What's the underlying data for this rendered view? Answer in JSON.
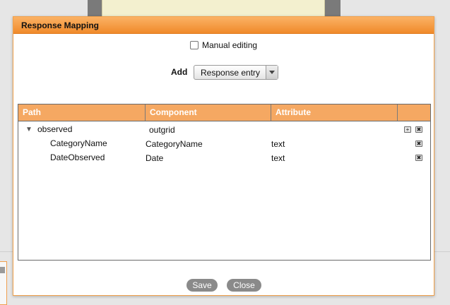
{
  "dialog": {
    "title": "Response Mapping",
    "manual_editing_label": "Manual editing",
    "manual_editing_checked": false,
    "add_label": "Add",
    "add_select_value": "Response entry",
    "save_label": "Save",
    "close_label": "Close"
  },
  "table": {
    "headers": [
      "Path",
      "Component",
      "Attribute",
      ""
    ],
    "rows": [
      {
        "path": "observed",
        "component": "outgrid",
        "attribute": "",
        "expanded": true,
        "actions": [
          "add-icon",
          "delete-icon"
        ]
      },
      {
        "path": "CategoryName",
        "component": "CategoryName",
        "attribute": "text",
        "actions": [
          "delete-icon"
        ]
      },
      {
        "path": "DateObserved",
        "component": "Date",
        "attribute": "text",
        "actions": [
          "delete-icon"
        ]
      }
    ]
  },
  "icons": {
    "expand": "▼",
    "add": "+",
    "delete": "✖"
  },
  "colors": {
    "titlebar": "#f08a2a",
    "table_header": "#f5a862",
    "button": "#8a8a8a"
  }
}
